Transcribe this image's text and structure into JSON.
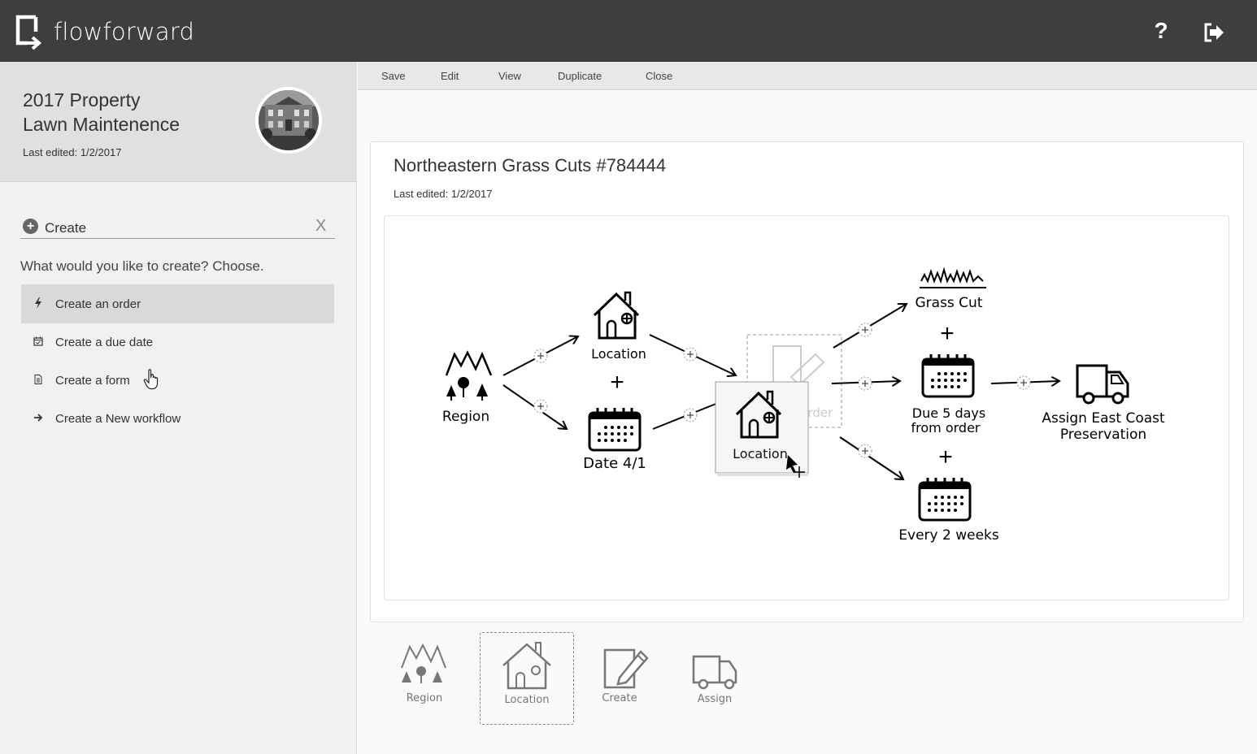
{
  "app": {
    "name": "flowforward"
  },
  "header": {
    "help_label": "?",
    "help_icon": "question-icon",
    "logout_icon": "logout-icon"
  },
  "project": {
    "title_line1": "2017 Property",
    "title_line2": "Lawn Maintenence",
    "last_edited": "Last edited: 1/2/2017"
  },
  "create": {
    "title": "Create",
    "close_label": "X",
    "question": "What would you like to create? Choose.",
    "items": [
      {
        "label": "Create an order",
        "icon": "bolt-icon"
      },
      {
        "label": "Create a due date",
        "icon": "calendar-check-icon"
      },
      {
        "label": "Create a form",
        "icon": "document-icon"
      },
      {
        "label": "Create a New workflow",
        "icon": "arrow-right-icon"
      }
    ]
  },
  "toolbar": {
    "save": "Save",
    "edit": "Edit",
    "view": "View",
    "duplicate": "Duplicate",
    "close": "Close"
  },
  "workflow": {
    "title": "Northeastern Grass Cuts  #784444",
    "last_edited": "Last edited: 1/2/2017",
    "nodes": {
      "region": "Region",
      "location": "Location",
      "date": "Date 4/1",
      "order_ghost": "Order",
      "dragging": "Location",
      "grass_cut": "Grass Cut",
      "due_line1": "Due 5 days",
      "due_line2": "from order",
      "every": "Every 2 weeks",
      "assign_line1": "Assign East Coast",
      "assign_line2": "Preservation"
    },
    "plus": "+"
  },
  "palette": [
    {
      "label": "Region",
      "icon": "region-icon"
    },
    {
      "label": "Location",
      "icon": "location-icon"
    },
    {
      "label": "Create",
      "icon": "create-icon"
    },
    {
      "label": "Assign",
      "icon": "assign-icon"
    }
  ],
  "colors": {
    "topbar": "#3e3e3e",
    "sidebar": "#f1f1f1",
    "active_item": "#d9d9d9"
  }
}
